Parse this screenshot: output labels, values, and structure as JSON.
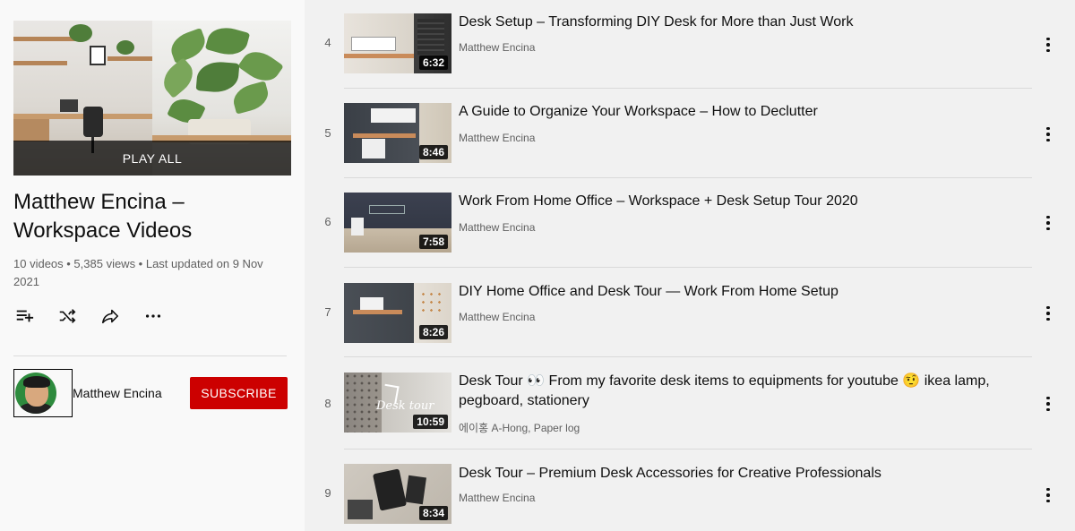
{
  "playlist": {
    "play_all": "PLAY ALL",
    "title": "Matthew Encina – Workspace Videos",
    "meta": "10 videos • 5,385 views • Last updated on 9 Nov 2021",
    "actions": [
      {
        "name": "save-to-queue-icon"
      },
      {
        "name": "shuffle-icon"
      },
      {
        "name": "share-icon"
      },
      {
        "name": "more-options-icon"
      }
    ],
    "owner": "Matthew Encina",
    "subscribe_label": "SUBSCRIBE"
  },
  "videos": [
    {
      "index": "4",
      "title": "Desk Setup – Transforming DIY Desk for More than Just Work",
      "channel": "Matthew Encina",
      "duration": "6:32"
    },
    {
      "index": "5",
      "title": "A Guide to Organize Your Workspace – How to Declutter",
      "channel": "Matthew Encina",
      "duration": "8:46"
    },
    {
      "index": "6",
      "title": "Work From Home Office – Workspace + Desk Setup Tour 2020",
      "channel": "Matthew Encina",
      "duration": "7:58"
    },
    {
      "index": "7",
      "title": "DIY Home Office and Desk Tour — Work From Home Setup",
      "channel": "Matthew Encina",
      "duration": "8:26"
    },
    {
      "index": "8",
      "title": "Desk Tour 👀 From my favorite desk items to equipments for youtube 🤨 ikea lamp, pegboard, stationery",
      "channel": "에이홍 A-Hong, Paper log",
      "duration": "10:59"
    },
    {
      "index": "9",
      "title": "Desk Tour – Premium Desk Accessories for Creative Professionals",
      "channel": "Matthew Encina",
      "duration": "8:34"
    }
  ],
  "colors": {
    "subscribe": "#cc0000",
    "background": "#f1f1f1",
    "sidebar": "#f9f9f9"
  }
}
